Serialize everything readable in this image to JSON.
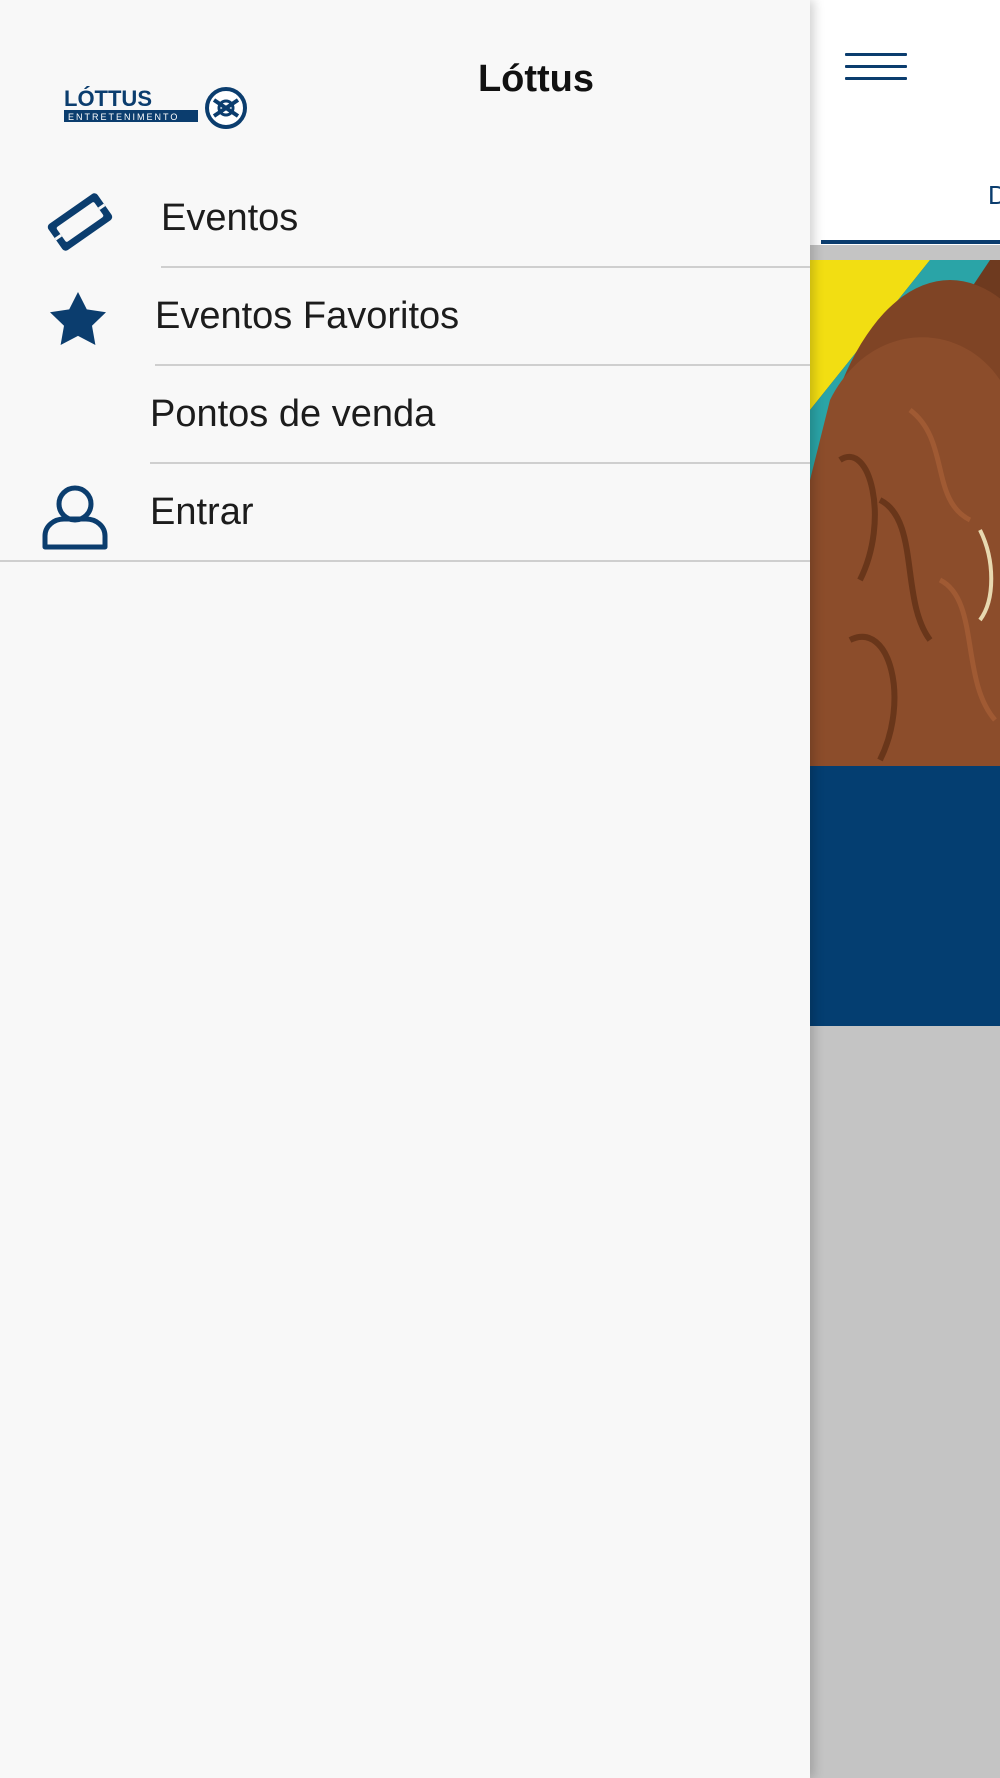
{
  "app": {
    "title": "Lóttus",
    "logo": {
      "main_text": "LÓTTUS",
      "sub_text": "ENTRETENIMENTO"
    }
  },
  "drawer": {
    "menu": [
      {
        "label": "Eventos",
        "icon": "ticket-icon"
      },
      {
        "label": "Eventos Favoritos",
        "icon": "star-icon"
      },
      {
        "label": "Pontos de venda",
        "icon": "none"
      },
      {
        "label": "Entrar",
        "icon": "user-icon"
      }
    ]
  },
  "background": {
    "tab_partial_label": "D",
    "menu_icon": "hamburger-icon"
  },
  "colors": {
    "brand": "#0b3d6e",
    "card": "#043e71",
    "drawer_bg": "#f8f8f8",
    "overlay": "#c4c4c4"
  }
}
